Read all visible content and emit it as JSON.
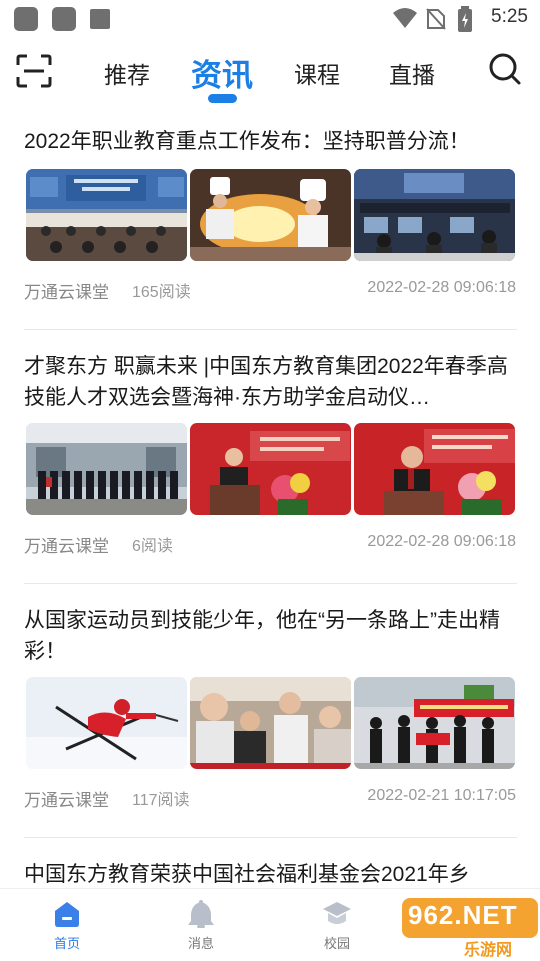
{
  "status_bar": {
    "time": "5:25"
  },
  "top_nav": {
    "tabs": [
      {
        "label": "推荐"
      },
      {
        "label": "资讯",
        "active": true
      },
      {
        "label": "课程"
      },
      {
        "label": "直播"
      }
    ]
  },
  "articles": [
    {
      "title": "2022年职业教育重点工作发布：坚持职普分流！",
      "source": "万通云课堂",
      "reads": "165阅读",
      "time": "2022-02-28 09:06:18",
      "thumbnails": [
        "photo-press-conference",
        "photo-chefs-cooking",
        "photo-computer-classroom"
      ]
    },
    {
      "title": "才聚东方 职赢未来 |中国东方教育集团2022年春季高技能人才双选会暨海神·东方助学金启动仪…",
      "source": "万通云课堂",
      "reads": "6阅读",
      "time": "2022-02-28 09:06:18",
      "thumbnails": [
        "photo-group-outdoor",
        "photo-speaker-podium",
        "photo-speaker-podium-2"
      ]
    },
    {
      "title": "从国家运动员到技能少年，他在“另一条路上”走出精彩！",
      "source": "万通云课堂",
      "reads": "117阅读",
      "time": "2022-02-21 10:17:05",
      "thumbnails": [
        "photo-skier",
        "photo-group-selfie",
        "photo-banner-group"
      ]
    },
    {
      "title": "中国东方教育荣获中国社会福利基金会2021年乡"
    }
  ],
  "bottom_nav": {
    "items": [
      {
        "label": "首页",
        "icon": "home-icon",
        "active": true
      },
      {
        "label": "消息",
        "icon": "bell-icon"
      },
      {
        "label": "校园",
        "icon": "graduation-cap-icon"
      }
    ]
  },
  "watermark": {
    "text": "962.NET",
    "subtext": "乐游网"
  },
  "colors": {
    "accent": "#1c7fe6",
    "muted_text": "#999999"
  }
}
